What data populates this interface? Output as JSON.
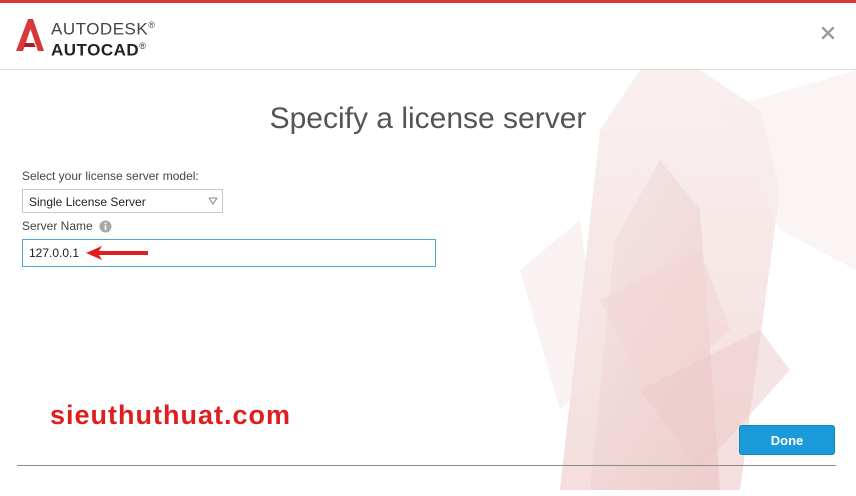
{
  "brand": {
    "line1": "AUTODESK",
    "line1_mark": "®",
    "line2": "AUTOCAD",
    "line2_mark": "®"
  },
  "page": {
    "title": "Specify a license server"
  },
  "form": {
    "model_label": "Select your license server model:",
    "model_value": "Single License Server",
    "server_label": "Server Name",
    "server_value": "127.0.0.1"
  },
  "watermark": "sieuthuthuat.com",
  "buttons": {
    "done": "Done"
  },
  "icons": {
    "logo": "autocad-logo-icon",
    "close": "close-icon",
    "info": "info-icon",
    "chevron": "chevron-down-icon",
    "arrow": "red-arrow-icon"
  },
  "colors": {
    "accent": "#1a9ad8",
    "brand_red": "#d8383a",
    "watermark": "#e01e1e"
  }
}
